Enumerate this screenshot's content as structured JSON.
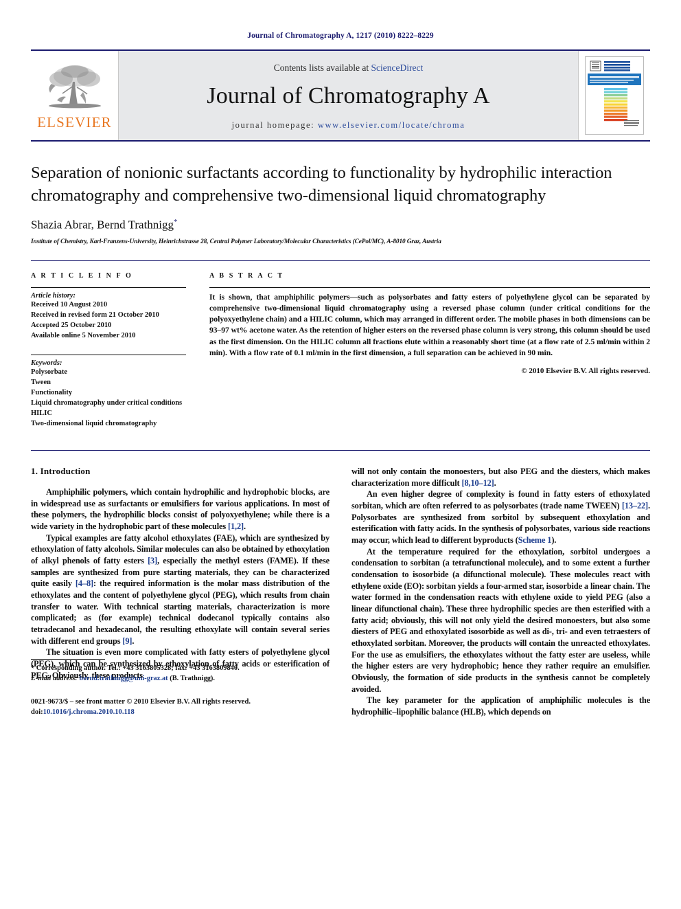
{
  "running_head": "Journal of Chromatography A, 1217 (2010) 8222–8229",
  "masthead": {
    "publisher_name": "ELSEVIER",
    "contents_prefix": "Contents lists available at",
    "contents_link": "ScienceDirect",
    "journal_title": "Journal of Chromatography A",
    "homepage_prefix": "journal homepage:",
    "homepage_url": "www.elsevier.com/locate/chroma",
    "cover_title": "JOURNAL OF CHROMATOGRAPHY A",
    "cover_subtitle": "INCLUDING ELECTROPHORESIS AND OTHER SEPARATION METHODS",
    "cover_footer": "Available online at",
    "cover_footer_brand": "ScienceDirect",
    "cover_footer_url": "www.sciencedirect.com"
  },
  "colors": {
    "brand_blue": "#1a1a6e",
    "link_blue": "#2b4a9b",
    "ref_blue": "#1f3f8f",
    "elsevier_orange": "#E87722",
    "masthead_grey": "#e7e8ea"
  },
  "title": "Separation of nonionic surfactants according to functionality by hydrophilic interaction chromatography and comprehensive two-dimensional liquid chromatography",
  "authors": "Shazia Abrar, Bernd Trathnigg",
  "author_marker": "*",
  "affiliation": "Institute of Chemistry, Karl-Franzens-University, Heinrichstrasse 28, Central Polymer Laboratory/Molecular Characteristics (CePol/MC), A-8010 Graz, Austria",
  "article_info": {
    "heading": "A R T I C L E   I N F O",
    "history_label": "Article history:",
    "history": [
      "Received 10 August 2010",
      "Received in revised form 21 October 2010",
      "Accepted 25 October 2010",
      "Available online 5 November 2010"
    ],
    "keywords_label": "Keywords:",
    "keywords": [
      "Polysorbate",
      "Tween",
      "Functionality",
      "Liquid chromatography under critical conditions",
      "HILIC",
      "Two-dimensional liquid chromatography"
    ]
  },
  "abstract": {
    "heading": "A B S T R A C T",
    "text": "It is shown, that amphiphilic polymers—such as polysorbates and fatty esters of polyethylene glycol can be separated by comprehensive two-dimensional liquid chromatography using a reversed phase column (under critical conditions for the polyoxyethylene chain) and a HILIC column, which may arranged in different order. The mobile phases in both dimensions can be 93–97 wt% acetone water. As the retention of higher esters on the reversed phase column is very strong, this column should be used as the first dimension. On the HILIC column all fractions elute within a reasonably short time (at a flow rate of 2.5 ml/min within 2 min). With a flow rate of 0.1 ml/min in the first dimension, a full separation can be achieved in 90 min.",
    "copyright": "© 2010 Elsevier B.V. All rights reserved."
  },
  "body": {
    "section_number_title": "1.  Introduction",
    "left_paragraphs": [
      "Amphiphilic polymers, which contain hydrophilic and hydrophobic blocks, are in widespread use as surfactants or emulsifiers for various applications. In most of these polymers, the hydrophilic blocks consist of polyoxyethylene; while there is a wide variety in the hydrophobic part of these molecules [1,2].",
      "Typical examples are fatty alcohol ethoxylates (FAE), which are synthesized by ethoxylation of fatty alcohols. Similar molecules can also be obtained by ethoxylation of alkyl phenols of fatty esters [3], especially the methyl esters (FAME). If these samples are synthesized from pure starting materials, they can be characterized quite easily [4–8]: the required information is the molar mass distribution of the ethoxylates and the content of polyethylene glycol (PEG), which results from chain transfer to water. With technical starting materials, characterization is more complicated; as (for example) technical dodecanol typically contains also tetradecanol and hexadecanol, the resulting ethoxylate will contain several series with different end groups [9].",
      "The situation is even more complicated with fatty esters of polyethylene glycol (PEG), which can be synthesized by ethoxylation of fatty acids or esterification of PEG. Obviously, these products"
    ],
    "right_paragraphs": [
      "will not only contain the monoesters, but also PEG and the diesters, which makes characterization more difficult [8,10–12].",
      "An even higher degree of complexity is found in fatty esters of ethoxylated sorbitan, which are often referred to as polysorbates (trade name TWEEN) [13–22]. Polysorbates are synthesized from sorbitol by subsequent ethoxylation and esterification with fatty acids. In the synthesis of polysorbates, various side reactions may occur, which lead to different byproducts (Scheme 1).",
      "At the temperature required for the ethoxylation, sorbitol undergoes a condensation to sorbitan (a tetrafunctional molecule), and to some extent a further condensation to isosorbide (a difunctional molecule). These molecules react with ethylene oxide (EO): sorbitan yields a four-armed star, isosorbide a linear chain. The water formed in the condensation reacts with ethylene oxide to yield PEG (also a linear difunctional chain). These three hydrophilic species are then esterified with a fatty acid; obviously, this will not only yield the desired monoesters, but also some diesters of PEG and ethoxylated isosorbide as well as di-, tri- and even tetraesters of ethoxylated sorbitan. Moreover, the products will contain the unreacted ethoxylates. For the use as emulsifiers, the ethoxylates without the fatty ester are useless, while the higher esters are very hydrophobic; hence they rather require an emulsifier. Obviously, the formation of side products in the synthesis cannot be completely avoided.",
      "The key parameter for the application of amphiphilic molecules is the hydrophilic–lipophilic balance (HLB), which depends on"
    ]
  },
  "footnote": {
    "corresponding": "* Corresponding author. Tel.: +43 3163805328; fax: +43 3163809840.",
    "email_label": "E-mail address:",
    "email": "bernd.trathnigg@uni-graz.at",
    "email_suffix": "(B. Trathnigg).",
    "issn_line": "0021-9673/$ – see front matter © 2010 Elsevier B.V. All rights reserved.",
    "doi_prefix": "doi:",
    "doi": "10.1016/j.chroma.2010.10.118"
  }
}
